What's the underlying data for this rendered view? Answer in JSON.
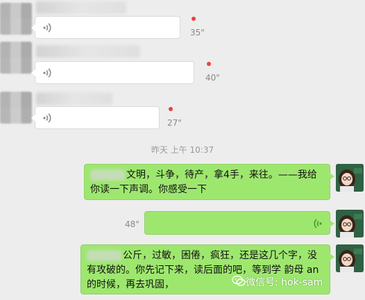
{
  "messages": [
    {
      "type": "voice",
      "side": "left",
      "duration": "35\"",
      "unread": true
    },
    {
      "type": "voice",
      "side": "left",
      "duration": "40\"",
      "unread": true
    },
    {
      "type": "voice",
      "side": "left",
      "duration": "27\"",
      "unread": true
    }
  ],
  "timestamp": "昨天 上午 10:37",
  "my_messages": [
    {
      "type": "text",
      "text": "文明，斗争，待产，拿4手，来往。——我给你读一下声调。你感受一下"
    },
    {
      "type": "voice",
      "duration": "48\""
    },
    {
      "type": "text",
      "text": "公斤，过敏，困倦，疯狂，还是这几个字，没有攻破的。你先记下来，读后面的吧，等到学 韵母 an 的时候，再去巩固，"
    }
  ],
  "watermark": {
    "text": "微信号: hok-sam",
    "icon": "wechat-icon"
  },
  "colors": {
    "my_bubble": "#9ee76f",
    "unread_dot": "#e64340",
    "background": "#ededed"
  }
}
